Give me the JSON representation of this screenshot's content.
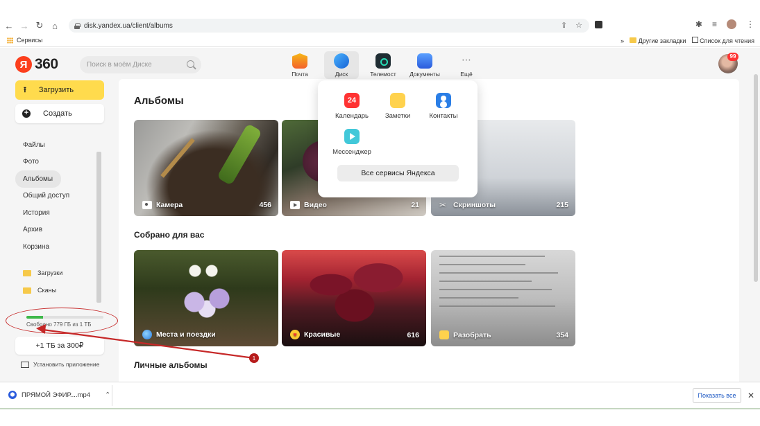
{
  "browser": {
    "url": "disk.yandex.ua/client/albums",
    "bookmarks_apps": "Сервисы",
    "bookmarks_other": "Другие закладки",
    "reading_list": "Список для чтения"
  },
  "header": {
    "logo_letter": "Я",
    "logo_text": "360",
    "search_placeholder": "Поиск в моём Диске",
    "services": [
      {
        "label": "Почта",
        "icon": "mail-icon"
      },
      {
        "label": "Диск",
        "icon": "disk-icon"
      },
      {
        "label": "Телемост",
        "icon": "telemost-icon"
      },
      {
        "label": "Документы",
        "icon": "documents-icon"
      },
      {
        "label": "Ещё",
        "icon": "more-icon"
      }
    ],
    "avatar_badge": "99"
  },
  "sidebar": {
    "upload_label": "Загрузить",
    "create_label": "Создать",
    "items": [
      "Файлы",
      "Фото",
      "Альбомы",
      "Общий доступ",
      "История",
      "Архив",
      "Корзина"
    ],
    "active_item": "Альбомы",
    "folders": [
      "Загрузки",
      "Сканы"
    ],
    "storage_text": "Свободно 779 ГБ из 1 ТБ",
    "storage_used_fraction": 0.22,
    "buy_label": "+1 ТБ за 300₽",
    "install_label": "Установить приложение"
  },
  "main": {
    "title": "Альбомы",
    "albums": [
      {
        "name": "Камера",
        "count": "456",
        "icon": "camera-icon"
      },
      {
        "name": "Видео",
        "count": "21",
        "icon": "video-icon"
      },
      {
        "name": "Скриншоты",
        "count": "215",
        "icon": "scissors-icon"
      }
    ],
    "collected_title": "Собрано для вас",
    "collected": [
      {
        "name": "Места и поездки",
        "count": "",
        "icon": "globe-icon"
      },
      {
        "name": "Красивые",
        "count": "616",
        "icon": "heart-eyes-icon"
      },
      {
        "name": "Разобрать",
        "count": "354",
        "icon": "masks-icon"
      }
    ],
    "personal_title": "Личные альбомы"
  },
  "services_popup": {
    "items": [
      {
        "label": "Календарь",
        "badge": "24"
      },
      {
        "label": "Заметки"
      },
      {
        "label": "Контакты"
      },
      {
        "label": "Мессенджер"
      }
    ],
    "all_label": "Все сервисы Яндекса"
  },
  "annotation": {
    "marker_number": "1",
    "ring_color": "#c62828"
  },
  "downloads": {
    "file_name": "ПРЯМОЙ ЭФИР....mp4",
    "show_all": "Показать все"
  },
  "colors": {
    "accent_yellow": "#ffdb4d",
    "storage_green": "#3eb84a",
    "logo_red": "#fc3f1d"
  }
}
